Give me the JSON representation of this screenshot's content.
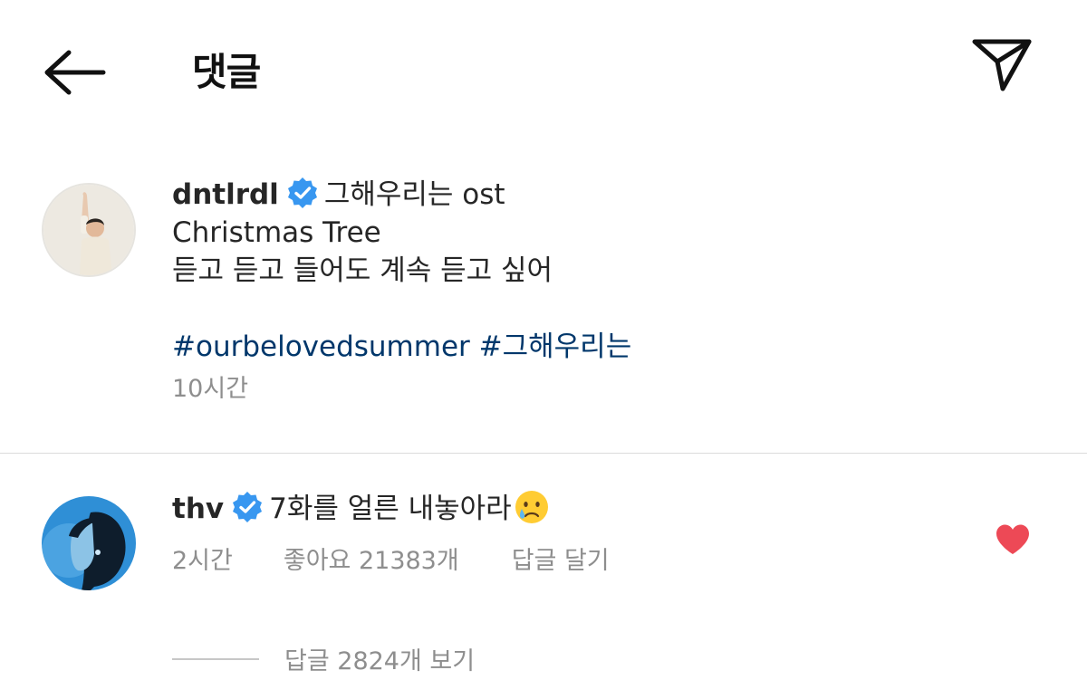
{
  "header": {
    "title": "댓글",
    "back_icon": "arrow-left-icon",
    "share_icon": "paper-plane-icon"
  },
  "post": {
    "username": "dntlrdl",
    "verified": true,
    "caption_inline": "그해우리는 ost",
    "caption_lines": [
      "Christmas Tree",
      "듣고 듣고 들어도 계속 듣고 싶어"
    ],
    "hashtags": [
      "#ourbelovedsummer",
      "#그해우리는"
    ],
    "time": "10시간"
  },
  "comment": {
    "username": "thv",
    "verified": true,
    "text": "7화를 얼른 내놓아라",
    "emoji": "crying-face-emoji",
    "time": "2시간",
    "likes": "좋아요 21383개",
    "reply_label": "답글 달기",
    "liked": true,
    "view_replies": "답글 2824개 보기"
  },
  "colors": {
    "verified_blue": "#3897f0",
    "hashtag_blue": "#00376b",
    "heart_red": "#ed4956",
    "meta_gray": "#8e8e8e"
  }
}
